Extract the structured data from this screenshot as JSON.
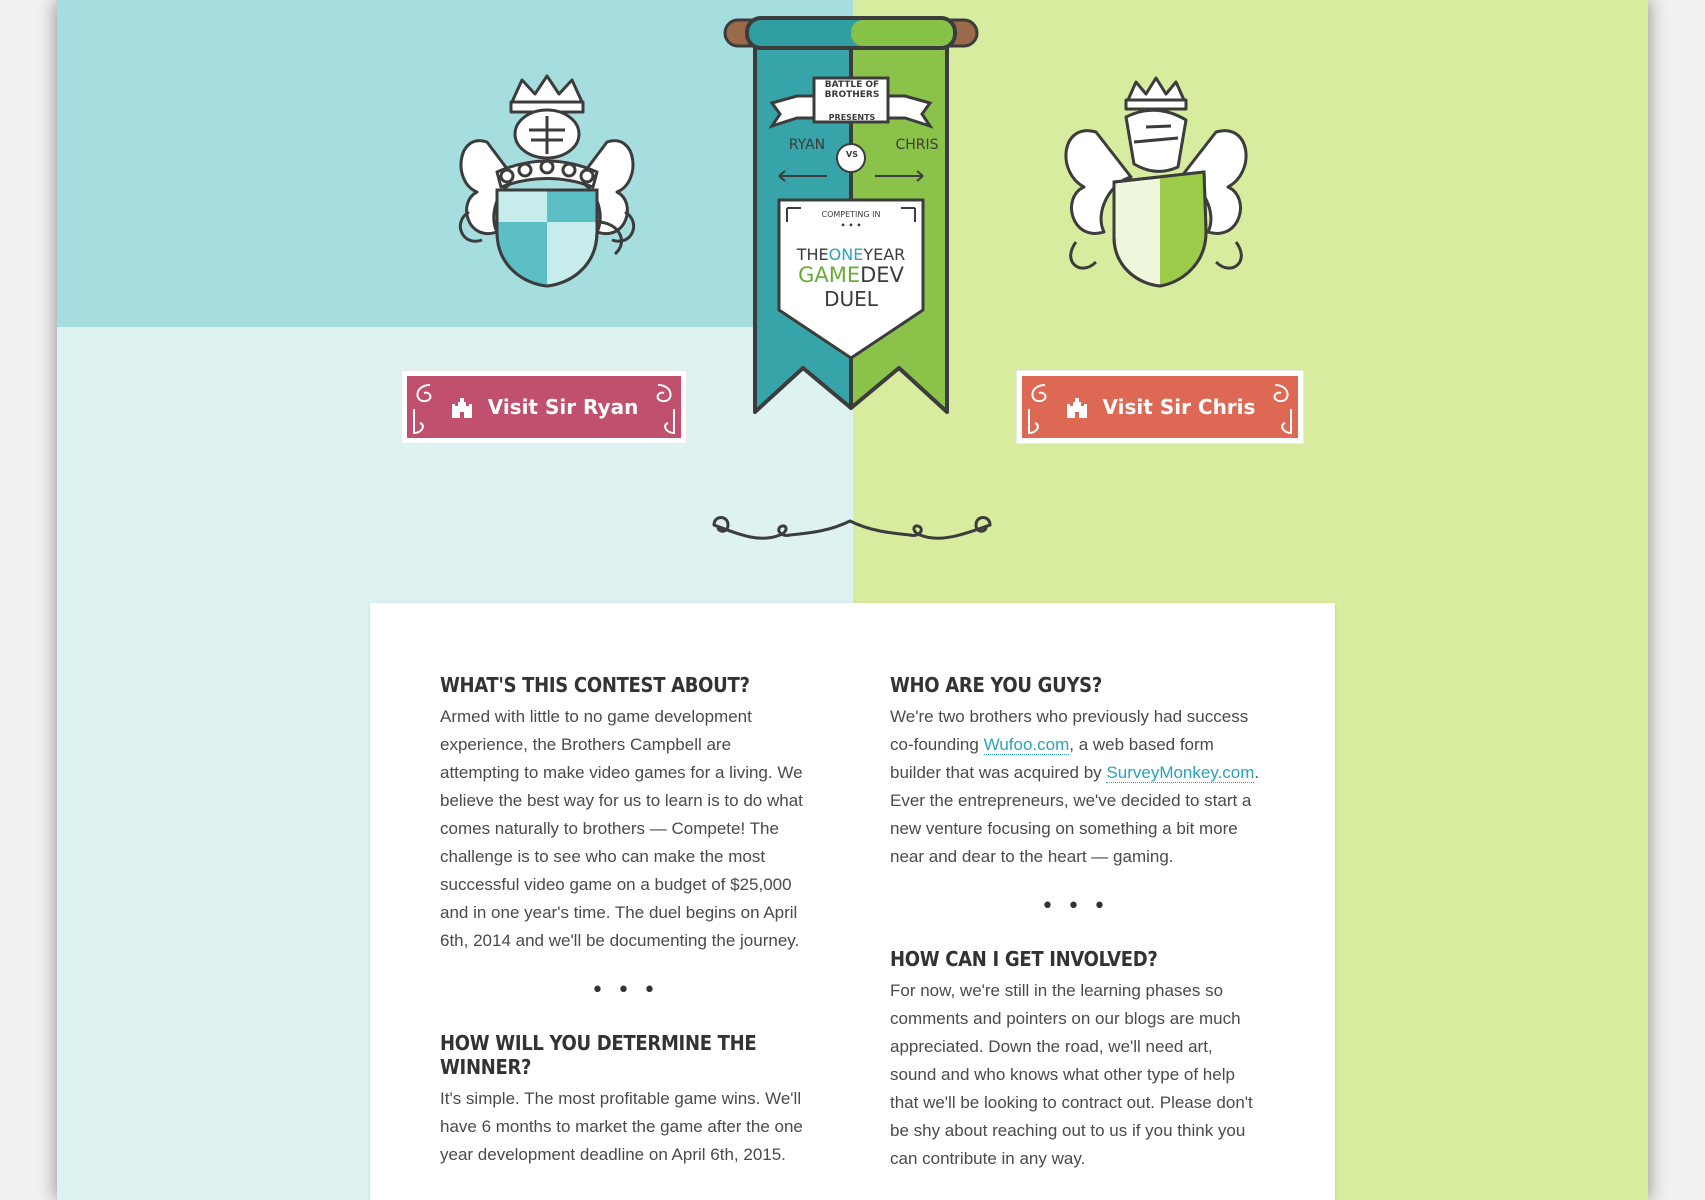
{
  "banner": {
    "publisher_line1": "BATTLE OF",
    "publisher_line2": "BROTHERS",
    "presents": "PRESENTS",
    "player_left": "RYAN",
    "versus": "VS",
    "player_right": "CHRIS",
    "competing_in": "COMPETING IN",
    "title_the": "THE",
    "title_one": "ONE",
    "title_year": "YEAR",
    "title_game": "GAME",
    "title_dev": "DEV",
    "title_duel": "DUEL"
  },
  "buttons": {
    "visit_ryan": "Visit Sir Ryan",
    "visit_chris": "Visit Sir Chris"
  },
  "faq": {
    "contest": {
      "heading": "WHAT'S THIS CONTEST ABOUT?",
      "body": "Armed with little to no game development experience, the Brothers Campbell are attempting to make video games for a living. We believe the best way for us to learn is to do what comes naturally to brothers — Compete! The challenge is to see who can make the most successful video game on a budget of $25,000 and in one year's time. The duel begins on April 6th, 2014 and we'll be documenting the journey."
    },
    "winner": {
      "heading": "HOW WILL YOU DETERMINE THE WINNER?",
      "body": "It's simple. The most profitable game wins. We'll have 6 months to market the game after the one year development deadline on April 6th, 2015."
    },
    "who": {
      "heading": "WHO ARE YOU GUYS?",
      "body_1": "We're two brothers who previously had success co-founding ",
      "link_1": "Wufoo.com",
      "body_2": ", a web based form builder that was acquired by ",
      "link_2": "SurveyMonkey.com",
      "body_3": ". Ever the entrepreneurs, we've decided to start a new venture focusing on something a bit more near and dear to the heart — gaming."
    },
    "involved": {
      "heading": "HOW CAN I GET INVOLVED?",
      "body": "For now, we're still in the learning phases so comments and pointers on our blogs are much appreciated. Down the road, we'll need art, sound and who knows what other type of help that we'll be looking to contract out. Please don't be shy about reaching out to us if you think you can contribute in any way."
    },
    "separator": "• • •"
  },
  "colors": {
    "teal_top": "#a6dedf",
    "teal_light": "#dff2f2",
    "green": "#d8ec9f",
    "ryan_button": "#c0506e",
    "chris_button": "#dd6955",
    "link": "#2aa3b8"
  },
  "icons": {
    "crest_left": "ryan-coat-of-arms-icon",
    "crest_right": "chris-coat-of-arms-icon",
    "button_icon": "castle-icon",
    "divider": "swirl-divider-icon"
  }
}
